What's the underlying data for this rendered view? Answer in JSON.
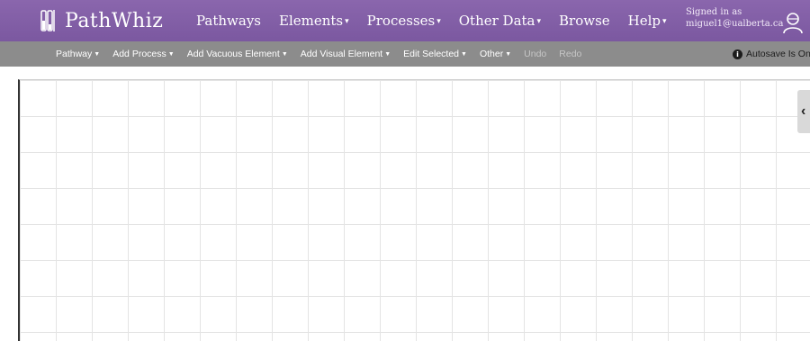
{
  "brand": {
    "name": "PathWhiz"
  },
  "nav": {
    "items": [
      {
        "label": "Pathways",
        "dropdown": false
      },
      {
        "label": "Elements",
        "dropdown": true
      },
      {
        "label": "Processes",
        "dropdown": true
      },
      {
        "label": "Other Data",
        "dropdown": true
      },
      {
        "label": "Browse",
        "dropdown": false
      },
      {
        "label": "Help",
        "dropdown": true
      }
    ],
    "signed_in_label": "Signed in as",
    "user_email": "miguel1@ualberta.ca"
  },
  "toolbar": {
    "items": [
      {
        "label": "Pathway",
        "dropdown": true,
        "enabled": true
      },
      {
        "label": "Add Process",
        "dropdown": true,
        "enabled": true
      },
      {
        "label": "Add Vacuous Element",
        "dropdown": true,
        "enabled": true
      },
      {
        "label": "Add Visual Element",
        "dropdown": true,
        "enabled": true
      },
      {
        "label": "Edit Selected",
        "dropdown": true,
        "enabled": true
      },
      {
        "label": "Other",
        "dropdown": true,
        "enabled": true
      },
      {
        "label": "Undo",
        "dropdown": false,
        "enabled": false
      },
      {
        "label": "Redo",
        "dropdown": false,
        "enabled": false
      }
    ],
    "autosave_text": "Autosave Is On"
  },
  "side_panel": {
    "toggle_icon": "chevron-left-icon"
  },
  "colors": {
    "nav_bg": "#7f5ba3",
    "toolbar_bg": "#8c8c8c",
    "grid_line": "#e4e4e4"
  }
}
